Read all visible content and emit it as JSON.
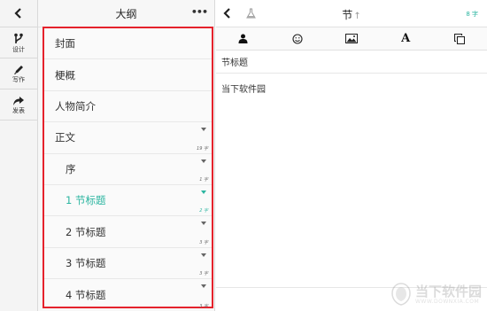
{
  "left_toolbar": {
    "back_icon": "chevron-left-icon",
    "tools": [
      {
        "label": "设计",
        "icon": "fork-icon"
      },
      {
        "label": "写作",
        "icon": "pencil-icon"
      },
      {
        "label": "发表",
        "icon": "share-icon"
      }
    ]
  },
  "outline": {
    "title": "大纲",
    "more_label": "•••",
    "items": [
      {
        "label": "封面",
        "level": 0
      },
      {
        "label": "梗概",
        "level": 0
      },
      {
        "label": "人物简介",
        "level": 0
      },
      {
        "label": "正文",
        "level": 0,
        "count": "19 字"
      },
      {
        "label": "序",
        "level": 1,
        "count": "1 字"
      },
      {
        "label": "1 节标题",
        "level": 1,
        "count": "2 字",
        "active": true
      },
      {
        "label": "2 节标题",
        "level": 1,
        "count": "3 字"
      },
      {
        "label": "3 节标题",
        "level": 1,
        "count": "3 字"
      },
      {
        "label": "4 节标题",
        "level": 1,
        "count": "3 字"
      }
    ]
  },
  "editor": {
    "title": "节",
    "title_arrow": "↑",
    "word_count": "8 字",
    "toolbar": [
      "person-icon",
      "smiley-icon",
      "image-icon",
      "font-icon",
      "copy-icon"
    ],
    "font_glyph": "A",
    "section_heading": "节标题",
    "body_text": "当下软件园"
  },
  "watermark": {
    "cn": "当下软件园",
    "en": "WWW.DOWNXIA.COM"
  },
  "colors": {
    "accent": "#2bb5a0",
    "highlight_frame": "#e5222c"
  }
}
